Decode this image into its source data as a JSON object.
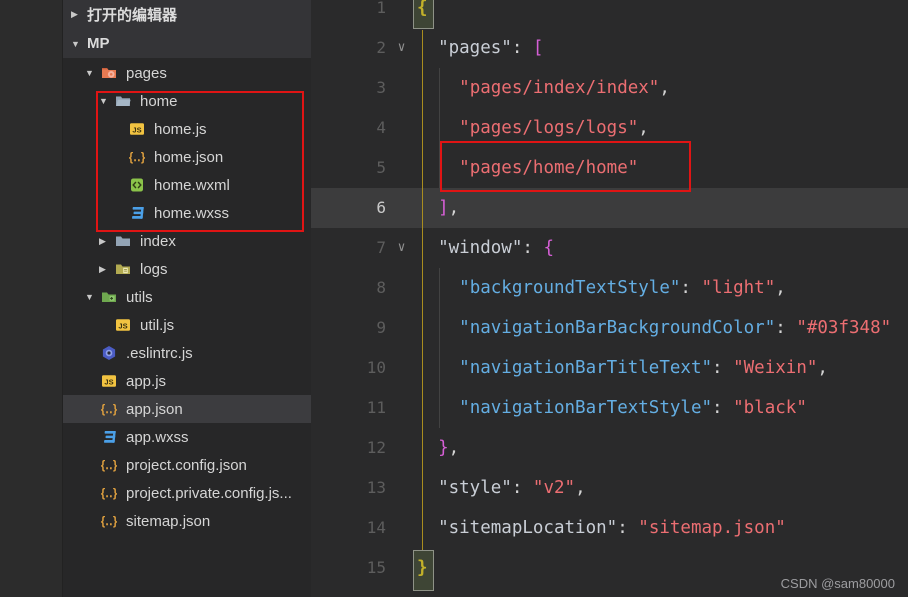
{
  "colors": {
    "annotation_red": "#e01414",
    "activity_strip": "#2c2c2c",
    "sidebar_background": "#272728",
    "header_row_background": "#343437",
    "selected_row_background": "#3c3c3f",
    "tree_text": "#d5d5d5",
    "editor_background": "#2a2a2b",
    "active_line_background": "#3c3c3d",
    "line_number": "#5d5d5d",
    "line_number_active": "#cacaca",
    "json_key_level1": "#c9ced6",
    "json_key_level2": "#64aee3",
    "json_string": "#ec6e72",
    "punctuation": "#d4d4d4",
    "bracket_gold": "#f5cf1b",
    "bracket_orchid": "#d65fd6",
    "indent_guide_gold": "#a98d1f",
    "indent_guide_gray": "#424242",
    "watermark_text": "#9d9da0"
  },
  "sidebar": {
    "items": [
      {
        "label": "打开的编辑器",
        "indent": 0,
        "arrow": "right",
        "icon": null,
        "header": true
      },
      {
        "label": "MP",
        "indent": 0,
        "arrow": "down",
        "icon": null,
        "header": true
      },
      {
        "label": "pages",
        "indent": 1,
        "arrow": "down",
        "icon": "pages-folder-icon"
      },
      {
        "label": "home",
        "indent": 2,
        "arrow": "down",
        "icon": "open-folder-icon"
      },
      {
        "label": "home.js",
        "indent": 3,
        "arrow": null,
        "icon": "js-file-icon"
      },
      {
        "label": "home.json",
        "indent": 3,
        "arrow": null,
        "icon": "json-file-icon"
      },
      {
        "label": "home.wxml",
        "indent": 3,
        "arrow": null,
        "icon": "wxml-file-icon"
      },
      {
        "label": "home.wxss",
        "indent": 3,
        "arrow": null,
        "icon": "wxss-file-icon"
      },
      {
        "label": "index",
        "indent": 2,
        "arrow": "right",
        "icon": "closed-folder-icon"
      },
      {
        "label": "logs",
        "indent": 2,
        "arrow": "right",
        "icon": "logs-folder-icon"
      },
      {
        "label": "utils",
        "indent": 1,
        "arrow": "down",
        "icon": "utils-folder-icon"
      },
      {
        "label": "util.js",
        "indent": 2,
        "arrow": null,
        "icon": "js-file-icon"
      },
      {
        "label": ".eslintrc.js",
        "indent": 1,
        "arrow": null,
        "icon": "eslint-file-icon"
      },
      {
        "label": "app.js",
        "indent": 1,
        "arrow": null,
        "icon": "js-file-icon"
      },
      {
        "label": "app.json",
        "indent": 1,
        "arrow": null,
        "icon": "json-file-icon",
        "selected": true
      },
      {
        "label": "app.wxss",
        "indent": 1,
        "arrow": null,
        "icon": "wxss-file-icon"
      },
      {
        "label": "project.config.json",
        "indent": 1,
        "arrow": null,
        "icon": "json-file-icon"
      },
      {
        "label": "project.private.config.js...",
        "indent": 1,
        "arrow": null,
        "icon": "json-file-icon"
      },
      {
        "label": "sitemap.json",
        "indent": 1,
        "arrow": null,
        "icon": "json-file-icon"
      }
    ]
  },
  "editor": {
    "watermark": "CSDN @sam80000",
    "lines": [
      {
        "n": "1",
        "indent": 0,
        "fold": false,
        "active": false,
        "tokens": [
          [
            "b0",
            "{"
          ]
        ]
      },
      {
        "n": "2",
        "indent": 1,
        "fold": true,
        "active": false,
        "tokens": [
          [
            "k1",
            "\"pages\""
          ],
          [
            "p",
            ": "
          ],
          [
            "b1",
            "["
          ]
        ]
      },
      {
        "n": "3",
        "indent": 2,
        "fold": false,
        "active": false,
        "tokens": [
          [
            "s",
            "\"pages/index/index\""
          ],
          [
            "p",
            ","
          ]
        ]
      },
      {
        "n": "4",
        "indent": 2,
        "fold": false,
        "active": false,
        "tokens": [
          [
            "s",
            "\"pages/logs/logs\""
          ],
          [
            "p",
            ","
          ]
        ]
      },
      {
        "n": "5",
        "indent": 2,
        "fold": false,
        "active": false,
        "tokens": [
          [
            "s",
            "\"pages/home/home\""
          ]
        ]
      },
      {
        "n": "6",
        "indent": 1,
        "fold": false,
        "active": true,
        "tokens": [
          [
            "b1",
            "]"
          ],
          [
            "p",
            ","
          ]
        ]
      },
      {
        "n": "7",
        "indent": 1,
        "fold": true,
        "active": false,
        "tokens": [
          [
            "k1",
            "\"window\""
          ],
          [
            "p",
            ": "
          ],
          [
            "b1",
            "{"
          ]
        ]
      },
      {
        "n": "8",
        "indent": 2,
        "fold": false,
        "active": false,
        "tokens": [
          [
            "k2",
            "\"backgroundTextStyle\""
          ],
          [
            "p",
            ": "
          ],
          [
            "s",
            "\"light\""
          ],
          [
            "p",
            ","
          ]
        ]
      },
      {
        "n": "9",
        "indent": 2,
        "fold": false,
        "active": false,
        "tokens": [
          [
            "k2",
            "\"navigationBarBackgroundColor\""
          ],
          [
            "p",
            ": "
          ],
          [
            "s",
            "\"#03f348\""
          ]
        ]
      },
      {
        "n": "10",
        "indent": 2,
        "fold": false,
        "active": false,
        "tokens": [
          [
            "k2",
            "\"navigationBarTitleText\""
          ],
          [
            "p",
            ": "
          ],
          [
            "s",
            "\"Weixin\""
          ],
          [
            "p",
            ","
          ]
        ]
      },
      {
        "n": "11",
        "indent": 2,
        "fold": false,
        "active": false,
        "tokens": [
          [
            "k2",
            "\"navigationBarTextStyle\""
          ],
          [
            "p",
            ": "
          ],
          [
            "s",
            "\"black\""
          ]
        ]
      },
      {
        "n": "12",
        "indent": 1,
        "fold": false,
        "active": false,
        "tokens": [
          [
            "b1",
            "}"
          ],
          [
            "p",
            ","
          ]
        ]
      },
      {
        "n": "13",
        "indent": 1,
        "fold": false,
        "active": false,
        "tokens": [
          [
            "k1",
            "\"style\""
          ],
          [
            "p",
            ": "
          ],
          [
            "s",
            "\"v2\""
          ],
          [
            "p",
            ","
          ]
        ]
      },
      {
        "n": "14",
        "indent": 1,
        "fold": false,
        "active": false,
        "tokens": [
          [
            "k1",
            "\"sitemapLocation\""
          ],
          [
            "p",
            ": "
          ],
          [
            "s",
            "\"sitemap.json\""
          ]
        ]
      },
      {
        "n": "15",
        "indent": 0,
        "fold": false,
        "active": false,
        "tokens": [
          [
            "b0",
            "}"
          ]
        ]
      }
    ]
  }
}
